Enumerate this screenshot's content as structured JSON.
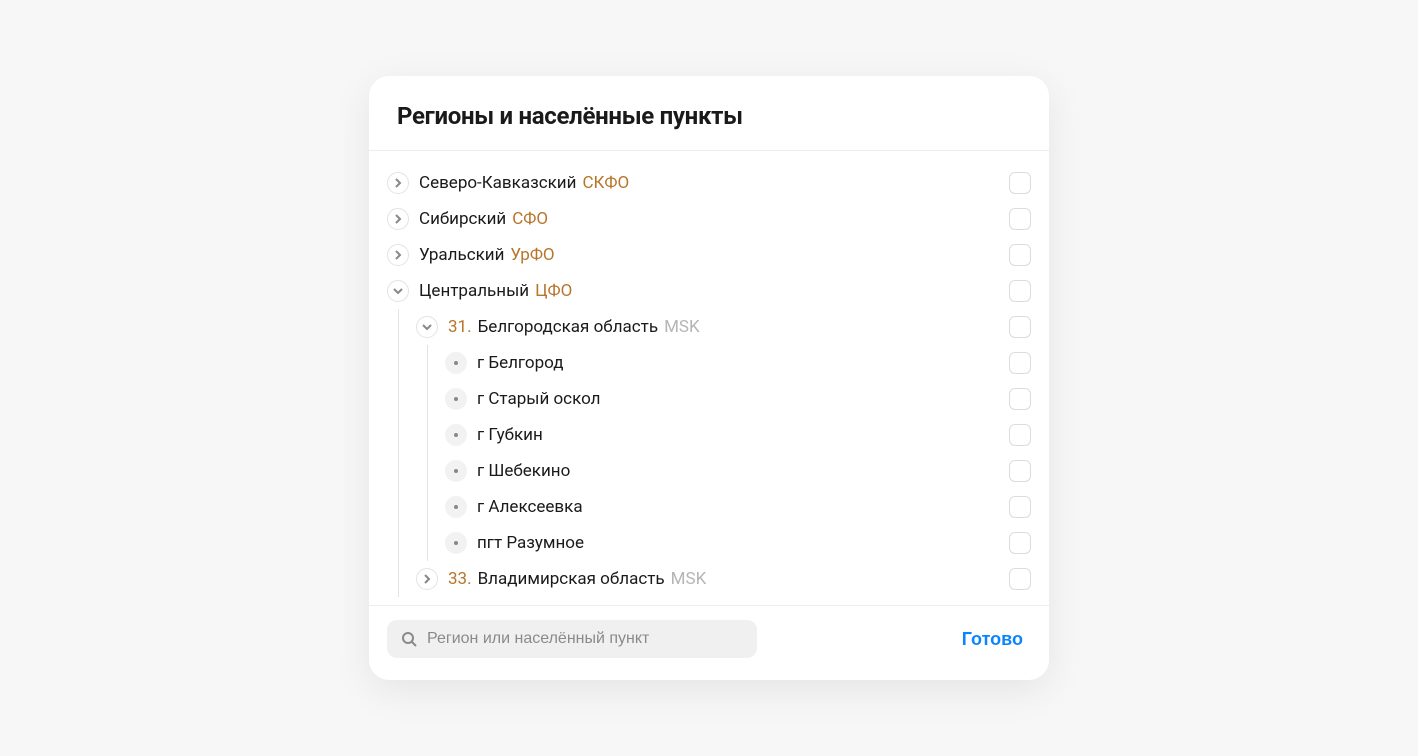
{
  "title": "Регионы и населённые пункты",
  "search": {
    "placeholder": "Регион или населённый пункт"
  },
  "footer": {
    "done": "Готово"
  },
  "regions": [
    {
      "name": "Северо-Кавказский",
      "code": "СКФО"
    },
    {
      "name": "Сибирский",
      "code": "СФО"
    },
    {
      "name": "Уральский",
      "code": "УрФО"
    },
    {
      "name": "Центральный",
      "code": "ЦФО"
    }
  ],
  "subregions": [
    {
      "num": "31.",
      "name": "Белгородская область",
      "tz": "MSK"
    },
    {
      "num": "33.",
      "name": "Владимирская область",
      "tz": "MSK"
    }
  ],
  "cities": [
    {
      "name": "г Белгород"
    },
    {
      "name": "г Старый оскол"
    },
    {
      "name": "г Губкин"
    },
    {
      "name": "г Шебекино"
    },
    {
      "name": "г Алексеевка"
    },
    {
      "name": "пгт Разумное"
    }
  ]
}
